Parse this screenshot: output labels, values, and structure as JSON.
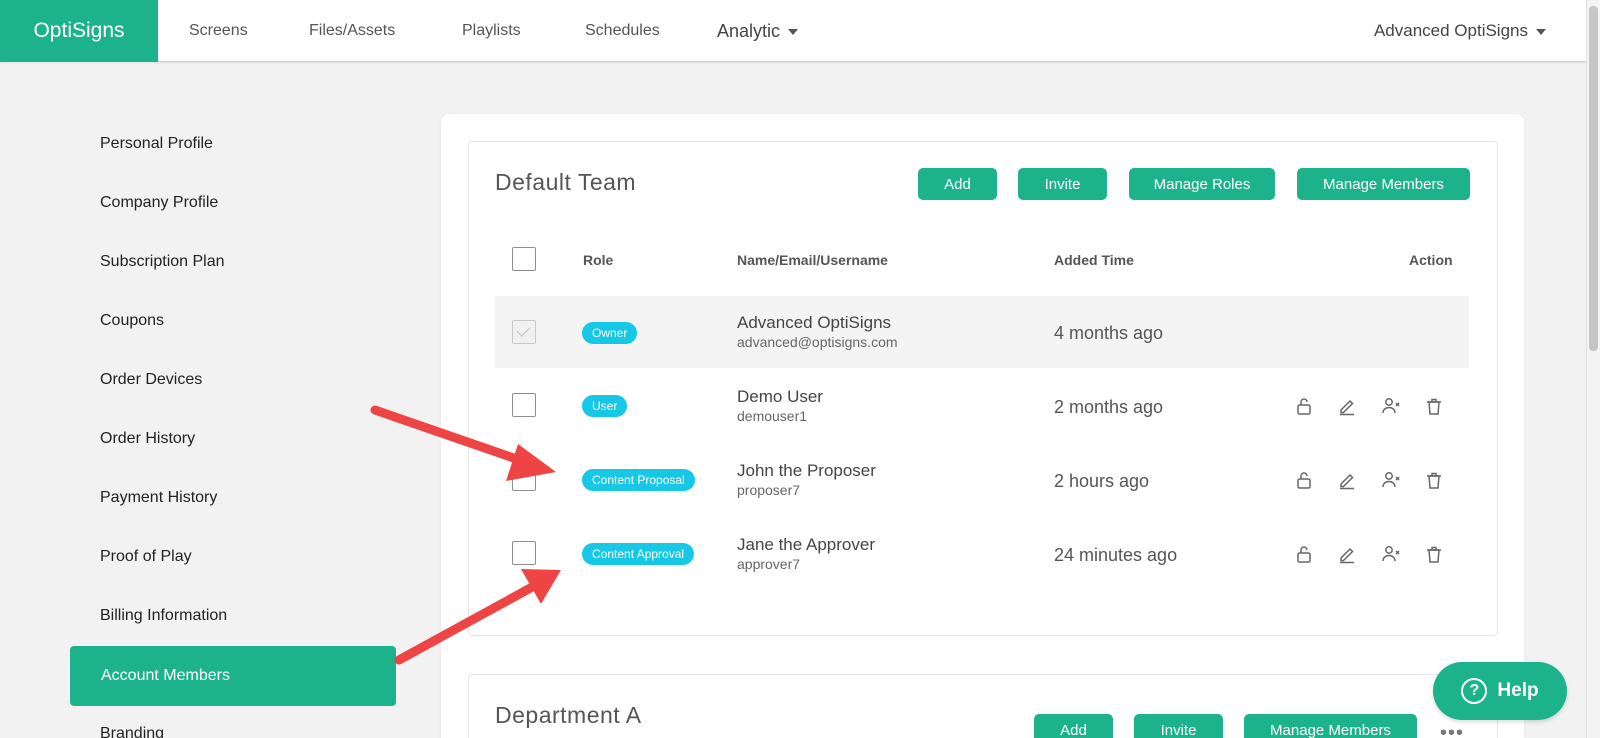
{
  "nav": {
    "logo": "OptiSigns",
    "items": [
      "Screens",
      "Files/Assets",
      "Playlists",
      "Schedules"
    ],
    "analytic": "Analytic",
    "account": "Advanced OptiSigns"
  },
  "sidebar": {
    "items": [
      "Personal Profile",
      "Company Profile",
      "Subscription Plan",
      "Coupons",
      "Order Devices",
      "Order History",
      "Payment History",
      "Proof of Play",
      "Billing Information",
      "Account Members",
      "Branding"
    ],
    "active": "Account Members"
  },
  "team": {
    "title": "Default Team",
    "buttons": [
      "Add",
      "Invite",
      "Manage Roles",
      "Manage Members"
    ],
    "columns": {
      "role": "Role",
      "name": "Name/Email/Username",
      "added": "Added Time",
      "action": "Action"
    },
    "members": [
      {
        "role": "Owner",
        "name": "Advanced OptiSigns",
        "sub": "advanced@optisigns.com",
        "added": "4 months ago"
      },
      {
        "role": "User",
        "name": "Demo User",
        "sub": "demouser1",
        "added": "2 months ago"
      },
      {
        "role": "Content Proposal",
        "name": "John the Proposer",
        "sub": "proposer7",
        "added": "2 hours ago"
      },
      {
        "role": "Content Approval",
        "name": "Jane the Approver",
        "sub": "approver7",
        "added": "24 minutes ago"
      }
    ]
  },
  "team2": {
    "title": "Department A",
    "buttons": [
      "Add",
      "Invite",
      "Manage Members"
    ]
  },
  "help": {
    "label": "Help",
    "icon": "question-icon"
  },
  "colors": {
    "brand": "#1cb38c",
    "badge": "#16c8e6",
    "arrow": "#ef4444"
  }
}
